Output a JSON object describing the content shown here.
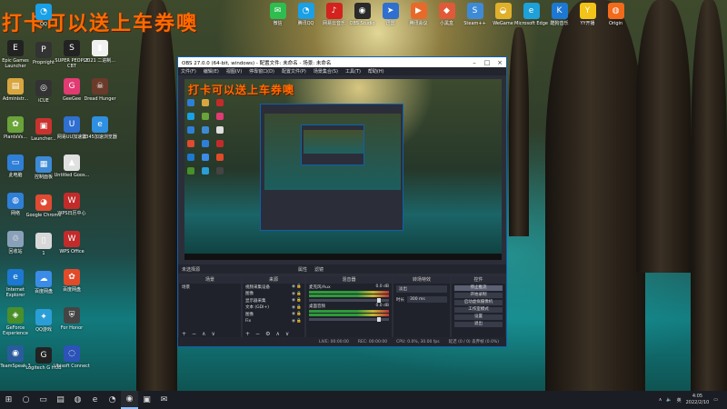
{
  "watermark": "打卡可以送上车券噢",
  "desktop": {
    "column1": [
      {
        "label": "Epic Games Launcher",
        "color": "#222222",
        "glyph": "E"
      },
      {
        "label": "Administr...",
        "color": "#d8a640",
        "glyph": "▤"
      },
      {
        "label": "PlantsVs...",
        "color": "#6aa33a",
        "glyph": "✿"
      },
      {
        "label": "此电脑",
        "color": "#2f7fd8",
        "glyph": "▭"
      },
      {
        "label": "网络",
        "color": "#2f7fd8",
        "glyph": "◍"
      },
      {
        "label": "回收站",
        "color": "#8aa0b8",
        "glyph": "♲"
      },
      {
        "label": "Internet Explorer",
        "color": "#1d78d3",
        "glyph": "e"
      },
      {
        "label": "GeForce Experience",
        "color": "#4a8f2a",
        "glyph": "◈"
      },
      {
        "label": "TeamSpeak 3",
        "color": "#2a5b9e",
        "glyph": "◉"
      }
    ],
    "column2": [
      {
        "label": "QQ",
        "color": "#1aa0e6",
        "glyph": "◔"
      },
      {
        "label": "Propnight",
        "color": "#333333",
        "glyph": "P"
      },
      {
        "label": "iCUE",
        "color": "#333333",
        "glyph": "◎"
      },
      {
        "label": "Launcher...",
        "color": "#c9332f",
        "glyph": "▣"
      },
      {
        "label": "控制面板",
        "color": "#3d8bd6",
        "glyph": "▦"
      },
      {
        "label": "Google Chrome",
        "color": "#e04a32",
        "glyph": "◕"
      },
      {
        "label": "1",
        "color": "#d8d8d8",
        "glyph": "▯"
      },
      {
        "label": "百度网盘",
        "color": "#3b8ce8",
        "glyph": "☁"
      },
      {
        "label": "QQ游戏",
        "color": "#2b9ed8",
        "glyph": "✦"
      },
      {
        "label": "Logitech G HUB",
        "color": "#222222",
        "glyph": "G"
      }
    ],
    "column3": [
      {
        "label": "SUPER PEOPLE CBT",
        "color": "#222222",
        "glyph": "S"
      },
      {
        "label": "GeeGee",
        "color": "#e23a72",
        "glyph": "G"
      },
      {
        "label": "网易UU加速器",
        "color": "#2f6fd0",
        "glyph": "U"
      },
      {
        "label": "Untitled Goos...",
        "color": "#e0e0e0",
        "glyph": "▲"
      },
      {
        "label": "WPS日历中心",
        "color": "#c32b2b",
        "glyph": "W"
      },
      {
        "label": "WPS Office",
        "color": "#c32b2b",
        "glyph": "W"
      },
      {
        "label": "百度网盘",
        "color": "#e24a2a",
        "glyph": "✿"
      },
      {
        "label": "For Honor",
        "color": "#444444",
        "glyph": "⛨"
      },
      {
        "label": "Ubisoft Connect",
        "color": "#2b53b8",
        "glyph": "◌"
      }
    ],
    "column4": [
      {
        "label": "2021 二进制...",
        "color": "#f0f0f0",
        "glyph": "▮"
      },
      {
        "label": "Dread Hunger",
        "color": "#6a3a2a",
        "glyph": "☠"
      },
      {
        "label": "2345加速浏览器",
        "color": "#2f8fe0",
        "glyph": "e"
      }
    ],
    "top_row": [
      {
        "label": "微信",
        "color": "#2ebd4e",
        "glyph": "✉"
      },
      {
        "label": "腾讯QQ",
        "color": "#1aa0e6",
        "glyph": "◔"
      },
      {
        "label": "网易云音乐",
        "color": "#d3231f",
        "glyph": "♪"
      },
      {
        "label": "OBS Studio",
        "color": "#2a2a2a",
        "glyph": "◉"
      },
      {
        "label": "迅雷",
        "color": "#2f6fd0",
        "glyph": "➤"
      },
      {
        "label": "腾讯会议",
        "color": "#e86a2a",
        "glyph": "▶"
      },
      {
        "label": "小黑盒",
        "color": "#e05a3a",
        "glyph": "◆"
      },
      {
        "label": "Steam++",
        "color": "#3d8bd6",
        "glyph": "S"
      },
      {
        "label": "WeGame",
        "color": "#e0b02a",
        "glyph": "◒"
      },
      {
        "label": "Microsoft Edge",
        "color": "#1ea0d8",
        "glyph": "e"
      },
      {
        "label": "酷狗音乐",
        "color": "#1d78d3",
        "glyph": "K"
      },
      {
        "label": "YY开播",
        "color": "#f2c318",
        "glyph": "Y"
      },
      {
        "label": "Origin",
        "color": "#f26a1b",
        "glyph": "◍"
      }
    ]
  },
  "obs": {
    "title": "OBS 27.0.0 (64-bit, windows) - 配置文件: 未命名 - 场景: 未命名",
    "menu": [
      "文件(F)",
      "编辑(E)",
      "视图(V)",
      "停靠窗口(D)",
      "配置文件(P)",
      "场景集合(S)",
      "工具(T)",
      "帮助(H)"
    ],
    "strip_left": "未选择源",
    "strip_props": "属性",
    "strip_filters": "滤镜",
    "docks": {
      "scenes": {
        "title": "场景",
        "items": [
          "场景"
        ]
      },
      "sources": {
        "title": "来源",
        "items": [
          "视频采集设备",
          "图像",
          "显示器采集",
          "文本 (GDI+)",
          "图像",
          "Fix"
        ]
      },
      "mixer": {
        "title": "混音器",
        "channels": [
          {
            "name": "麦克风/Aux",
            "level": "0.0 dB"
          },
          {
            "name": "桌面音频",
            "level": "0.0 dB"
          }
        ]
      },
      "transitions": {
        "title": "转场特效",
        "type": "淡出",
        "duration_label": "时长",
        "duration": "300 ms"
      },
      "controls": {
        "title": "控件",
        "buttons": [
          "停止推流",
          "开始录制",
          "启动虚拟摄像机",
          "工作室模式",
          "设置",
          "退出"
        ]
      }
    },
    "status": [
      "LIVE: 00:00:00",
      "REC: 00:00:00",
      "CPU: 0.0%, 30.00 fps",
      "延迟 (0 / 0) 丢弃帧 (0.0%)"
    ]
  },
  "taskbar": {
    "items": [
      "⊞",
      "○",
      "▭",
      "▤",
      "◍",
      "e",
      "◔",
      "◉",
      "▣",
      "✉"
    ],
    "tray_lang": "英",
    "time": "4:05",
    "date": "2022/2/10"
  },
  "colors": {
    "accent": "#0e5fb0",
    "watermark": "#ff6a00"
  }
}
